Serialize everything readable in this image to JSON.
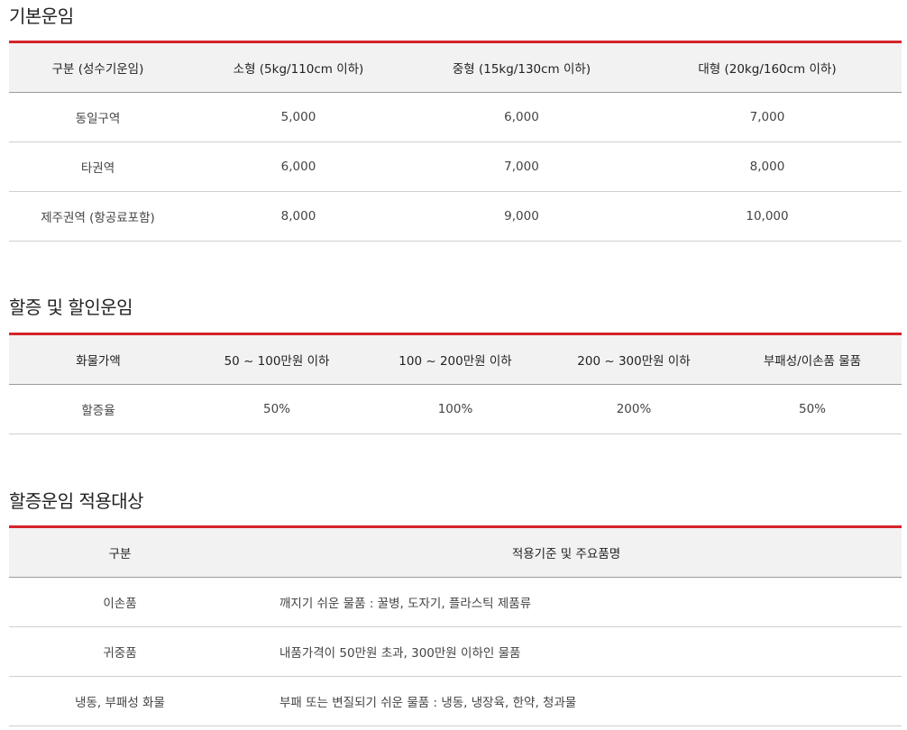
{
  "section1": {
    "title": "기본운임",
    "headers": [
      "구분 (성수기운임)",
      "소형 (5kg/110cm 이하)",
      "중형 (15kg/130cm 이하)",
      "대형 (20kg/160cm 이하)"
    ],
    "rows": [
      [
        "동일구역",
        "5,000",
        "6,000",
        "7,000"
      ],
      [
        "타권역",
        "6,000",
        "7,000",
        "8,000"
      ],
      [
        "제주권역 (항공료포함)",
        "8,000",
        "9,000",
        "10,000"
      ]
    ]
  },
  "section2": {
    "title": "할증 및 할인운임",
    "headers": [
      "화물가액",
      "50 ~ 100만원 이하",
      "100 ~ 200만원 이하",
      "200 ~ 300만원 이하",
      "부패성/이손품 물품"
    ],
    "rows": [
      [
        "할증율",
        "50%",
        "100%",
        "200%",
        "50%"
      ]
    ]
  },
  "section3": {
    "title": "할증운임 적용대상",
    "headers": [
      "구분",
      "적용기준 및 주요품명"
    ],
    "rows": [
      [
        "이손품",
        "깨지기 쉬운 물품 : 꿀병, 도자기, 플라스틱 제품류"
      ],
      [
        "귀중품",
        "내품가격이 50만원 초과, 300만원 이하인 물품"
      ],
      [
        "냉동, 부패성 화물",
        "부패 또는 변질되기 쉬운 물품 : 냉동, 냉장육, 한약, 청과물"
      ]
    ]
  }
}
